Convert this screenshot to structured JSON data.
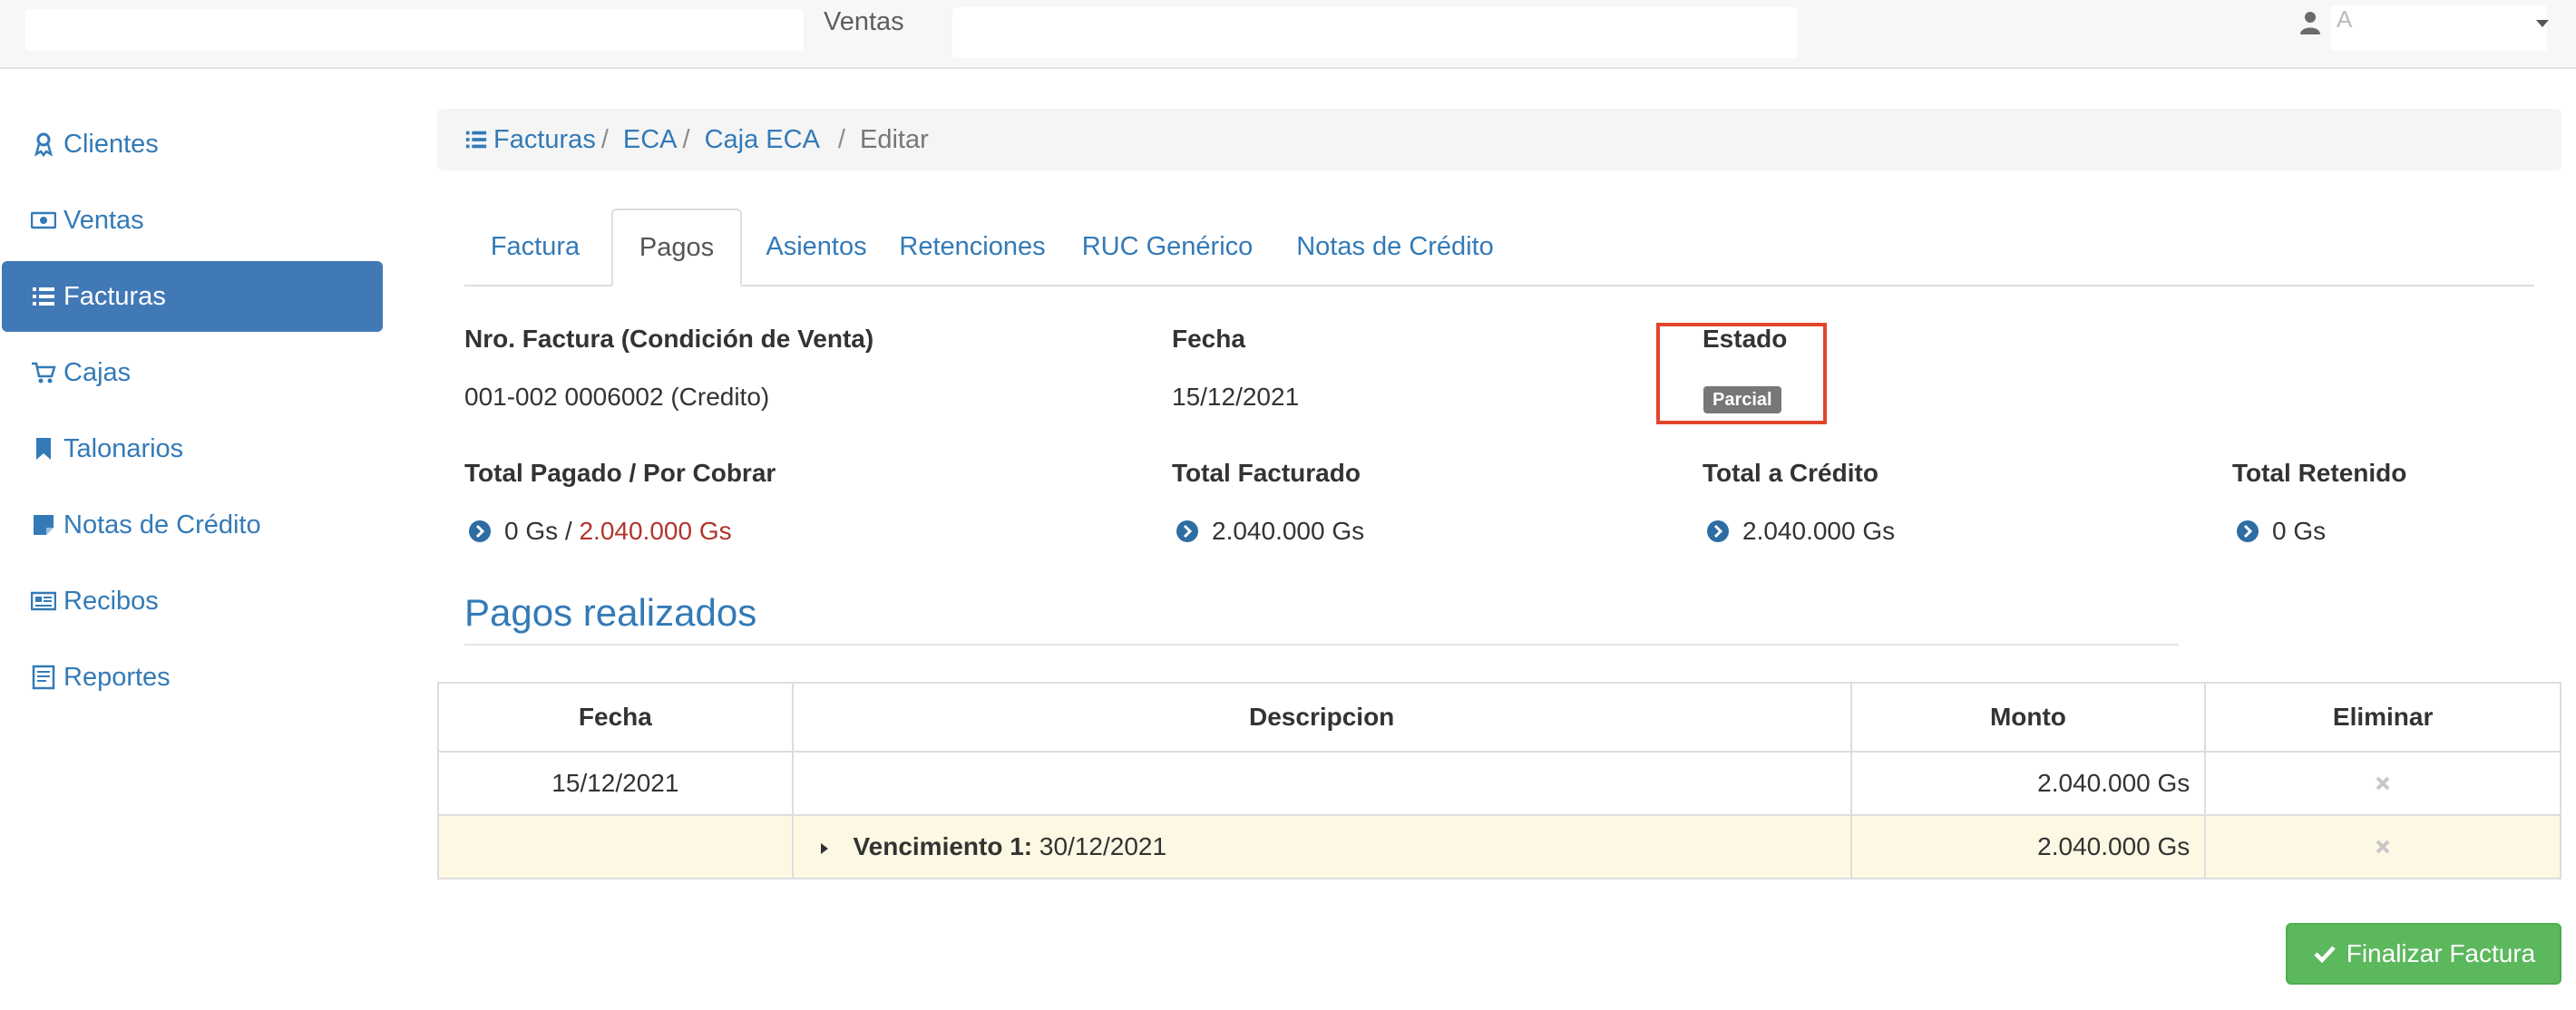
{
  "topbar": {
    "nav_label": "Ventas",
    "user_initial": "A"
  },
  "sidebar": {
    "items": [
      {
        "label": "Clientes",
        "icon": "user-certificate-icon"
      },
      {
        "label": "Ventas",
        "icon": "money-icon"
      },
      {
        "label": "Facturas",
        "icon": "list-icon",
        "active": true
      },
      {
        "label": "Cajas",
        "icon": "cart-icon"
      },
      {
        "label": "Talonarios",
        "icon": "bookmark-icon"
      },
      {
        "label": "Notas de Crédito",
        "icon": "note-icon"
      },
      {
        "label": "Recibos",
        "icon": "newspaper-icon"
      },
      {
        "label": "Reportes",
        "icon": "report-icon"
      }
    ]
  },
  "breadcrumb": {
    "items": [
      "Facturas",
      "ECA",
      "Caja ECA"
    ],
    "current": "Editar"
  },
  "tabs": [
    "Factura",
    "Pagos",
    "Asientos",
    "Retenciones",
    "RUC Genérico",
    "Notas de Crédito"
  ],
  "active_tab": "Pagos",
  "invoice": {
    "nro_label": "Nro. Factura (Condición de Venta)",
    "nro_value": "001-002 0006002 (Credito)",
    "fecha_label": "Fecha",
    "fecha_value": "15/12/2021",
    "estado_label": "Estado",
    "estado_value": "Parcial",
    "total_pagado_label": "Total Pagado / Por Cobrar",
    "total_pagado_value": "0 Gs",
    "por_cobrar_value": "2.040.000 Gs",
    "total_facturado_label": "Total Facturado",
    "total_facturado_value": "2.040.000 Gs",
    "total_credito_label": "Total a Crédito",
    "total_credito_value": "2.040.000 Gs",
    "total_retenido_label": "Total Retenido",
    "total_retenido_value": "0 Gs"
  },
  "pagos": {
    "title": "Pagos realizados",
    "columns": [
      "Fecha",
      "Descripcion",
      "Monto",
      "Eliminar"
    ],
    "row": {
      "fecha": "15/12/2021",
      "descripcion": "",
      "monto": "2.040.000 Gs"
    },
    "vencimiento": {
      "label": "Vencimiento 1:",
      "date": "30/12/2021",
      "monto": "2.040.000 Gs"
    }
  },
  "actions": {
    "finalizar_label": "Finalizar Factura"
  },
  "colors": {
    "accent": "#337ab7",
    "active_nav": "#4178b6",
    "success": "#5cb85c",
    "alert_red": "#b0352c",
    "highlight": "#e0452b"
  }
}
